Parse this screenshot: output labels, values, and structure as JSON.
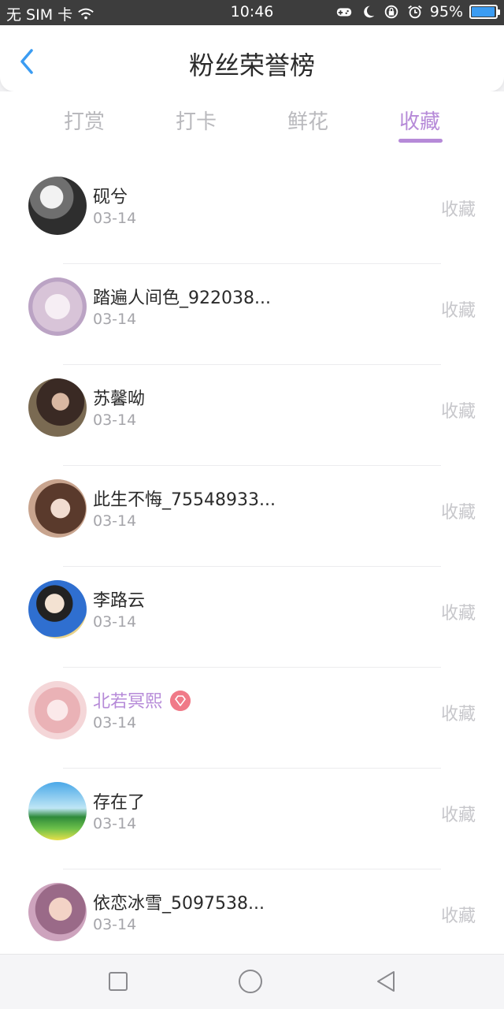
{
  "status_bar": {
    "carrier": "无 SIM 卡",
    "time": "10:46",
    "battery": "95%",
    "icons": [
      "wifi-icon",
      "game-icon",
      "moon-icon",
      "lock-rotation-icon",
      "alarm-icon",
      "battery-icon"
    ]
  },
  "header": {
    "title": "粉丝荣誉榜",
    "back_icon": "chevron-left-icon"
  },
  "tabs": [
    {
      "label": "打赏",
      "active": false
    },
    {
      "label": "打卡",
      "active": false
    },
    {
      "label": "鲜花",
      "active": false
    },
    {
      "label": "收藏",
      "active": true
    }
  ],
  "colors": {
    "accent": "#b68ad8",
    "back_arrow": "#3b9cf2",
    "vip_badge": "#f07a88",
    "muted": "#c7c7cb"
  },
  "fans": [
    {
      "name": "砚兮",
      "date": "03-14",
      "tag": "收藏",
      "vip": false
    },
    {
      "name": "踏遍人间色_922038...",
      "date": "03-14",
      "tag": "收藏",
      "vip": false
    },
    {
      "name": "苏馨呦",
      "date": "03-14",
      "tag": "收藏",
      "vip": false
    },
    {
      "name": "此生不悔_75548933...",
      "date": "03-14",
      "tag": "收藏",
      "vip": false
    },
    {
      "name": "李路云",
      "date": "03-14",
      "tag": "收藏",
      "vip": false
    },
    {
      "name": "北若冥熙",
      "date": "03-14",
      "tag": "收藏",
      "vip": true
    },
    {
      "name": "存在了",
      "date": "03-14",
      "tag": "收藏",
      "vip": false
    },
    {
      "name": "依恋冰雪_5097538...",
      "date": "03-14",
      "tag": "收藏",
      "vip": false
    }
  ],
  "nav_bar": {
    "icons": [
      "recent-apps-icon",
      "home-icon",
      "back-icon"
    ]
  }
}
